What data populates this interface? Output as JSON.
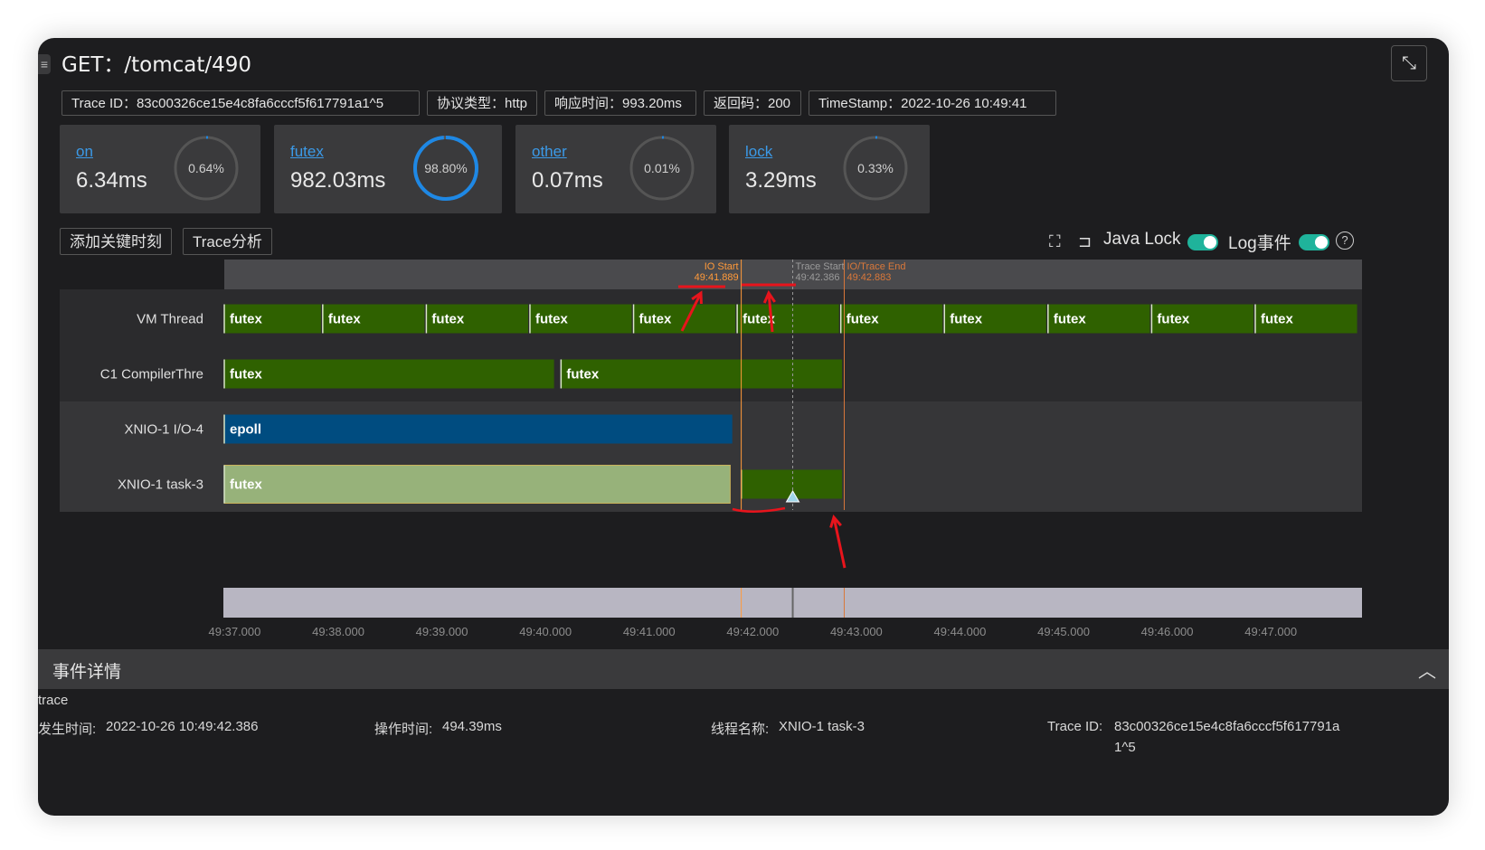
{
  "window": {
    "title": "GET：/tomcat/490"
  },
  "meta_tags": [
    {
      "label": "Trace ID：83c00326ce15e4c8fa6cccf5f617791a1^5"
    },
    {
      "label": "协议类型：http"
    },
    {
      "label": "响应时间：993.20ms"
    },
    {
      "label": "返回码：200"
    },
    {
      "label": "TimeStamp：2022-10-26 10:49:41"
    }
  ],
  "stats": [
    {
      "name": "on",
      "value": "6.34ms",
      "percent": "0.64%",
      "fraction": 0.0064
    },
    {
      "name": "futex",
      "value": "982.03ms",
      "percent": "98.80%",
      "fraction": 0.988
    },
    {
      "name": "other",
      "value": "0.07ms",
      "percent": "0.01%",
      "fraction": 0.0001
    },
    {
      "name": "lock",
      "value": "3.29ms",
      "percent": "0.33%",
      "fraction": 0.0033
    }
  ],
  "colors": {
    "accent_blue": "#1e88e5",
    "futex_green": "#2f6100",
    "futex_light": "#97b27a",
    "epoll_blue": "#004c80",
    "marker_orange": "#d9783a",
    "annotation_red": "#e8141c"
  },
  "toolbar": {
    "add_key_moment": "添加关键时刻",
    "trace_analysis": "Trace分析",
    "fit_icon": "fit-screen-icon",
    "reset_icon": "reset-icon",
    "java_lock_label": "Java Lock",
    "java_lock_on": true,
    "log_event_label": "Log事件",
    "log_event_on": true,
    "help_icon": "?"
  },
  "markers": [
    {
      "label": "IO Start",
      "time": "49:41.889",
      "t": 41.889
    },
    {
      "label": "Trace Start",
      "time": "49:42.386",
      "t": 42.386
    },
    {
      "label": "IO/Trace End",
      "time": "49:42.883",
      "t": 42.883
    }
  ],
  "timeline": {
    "t_start": 36.9,
    "t_end": 47.88,
    "threads": [
      {
        "name": "VM Thread",
        "segments": [
          {
            "label": "futex",
            "start": 36.9,
            "end": 37.85
          },
          {
            "label": "futex",
            "start": 37.85,
            "end": 38.85
          },
          {
            "label": "futex",
            "start": 38.85,
            "end": 39.85
          },
          {
            "label": "futex",
            "start": 39.85,
            "end": 40.85
          },
          {
            "label": "futex",
            "start": 40.85,
            "end": 41.85
          },
          {
            "label": "futex",
            "start": 41.85,
            "end": 42.85
          },
          {
            "label": "futex",
            "start": 42.85,
            "end": 43.85
          },
          {
            "label": "futex",
            "start": 43.85,
            "end": 44.85
          },
          {
            "label": "futex",
            "start": 44.85,
            "end": 45.85
          },
          {
            "label": "futex",
            "start": 45.85,
            "end": 46.85
          },
          {
            "label": "futex",
            "start": 46.85,
            "end": 47.85
          }
        ]
      },
      {
        "name": "C1 CompilerThre",
        "segments": [
          {
            "label": "futex",
            "start": 36.9,
            "end": 40.1
          },
          {
            "label": "futex",
            "start": 40.15,
            "end": 42.88
          }
        ]
      },
      {
        "name": "XNIO-1 I/O-4",
        "segments": [
          {
            "label": "epoll",
            "start": 36.9,
            "end": 41.82
          }
        ]
      },
      {
        "name": "XNIO-1 task-3",
        "segments": [
          {
            "label": "futex",
            "start": 36.9,
            "end": 41.8,
            "style": "light"
          },
          {
            "label": "",
            "start": 41.89,
            "end": 42.88
          }
        ]
      }
    ],
    "axis_ticks": [
      "49:37.000",
      "49:38.000",
      "49:39.000",
      "49:40.000",
      "49:41.000",
      "49:42.000",
      "49:43.000",
      "49:44.000",
      "49:45.000",
      "49:46.000",
      "49:47.000"
    ],
    "axis_tick_values": [
      37,
      38,
      39,
      40,
      41,
      42,
      43,
      44,
      45,
      46,
      47
    ]
  },
  "details": {
    "title": "事件详情",
    "type": "trace",
    "occur_time_label": "发生时间:",
    "occur_time": "2022-10-26 10:49:42.386",
    "op_time_label": "操作时间:",
    "op_time": "494.39ms",
    "thread_name_label": "线程名称:",
    "thread_name": "XNIO-1 task-3",
    "trace_id_label": "Trace ID:",
    "trace_id_line1": "83c00326ce15e4c8fa6cccf5f617791a",
    "trace_id_line2": "1^5"
  }
}
